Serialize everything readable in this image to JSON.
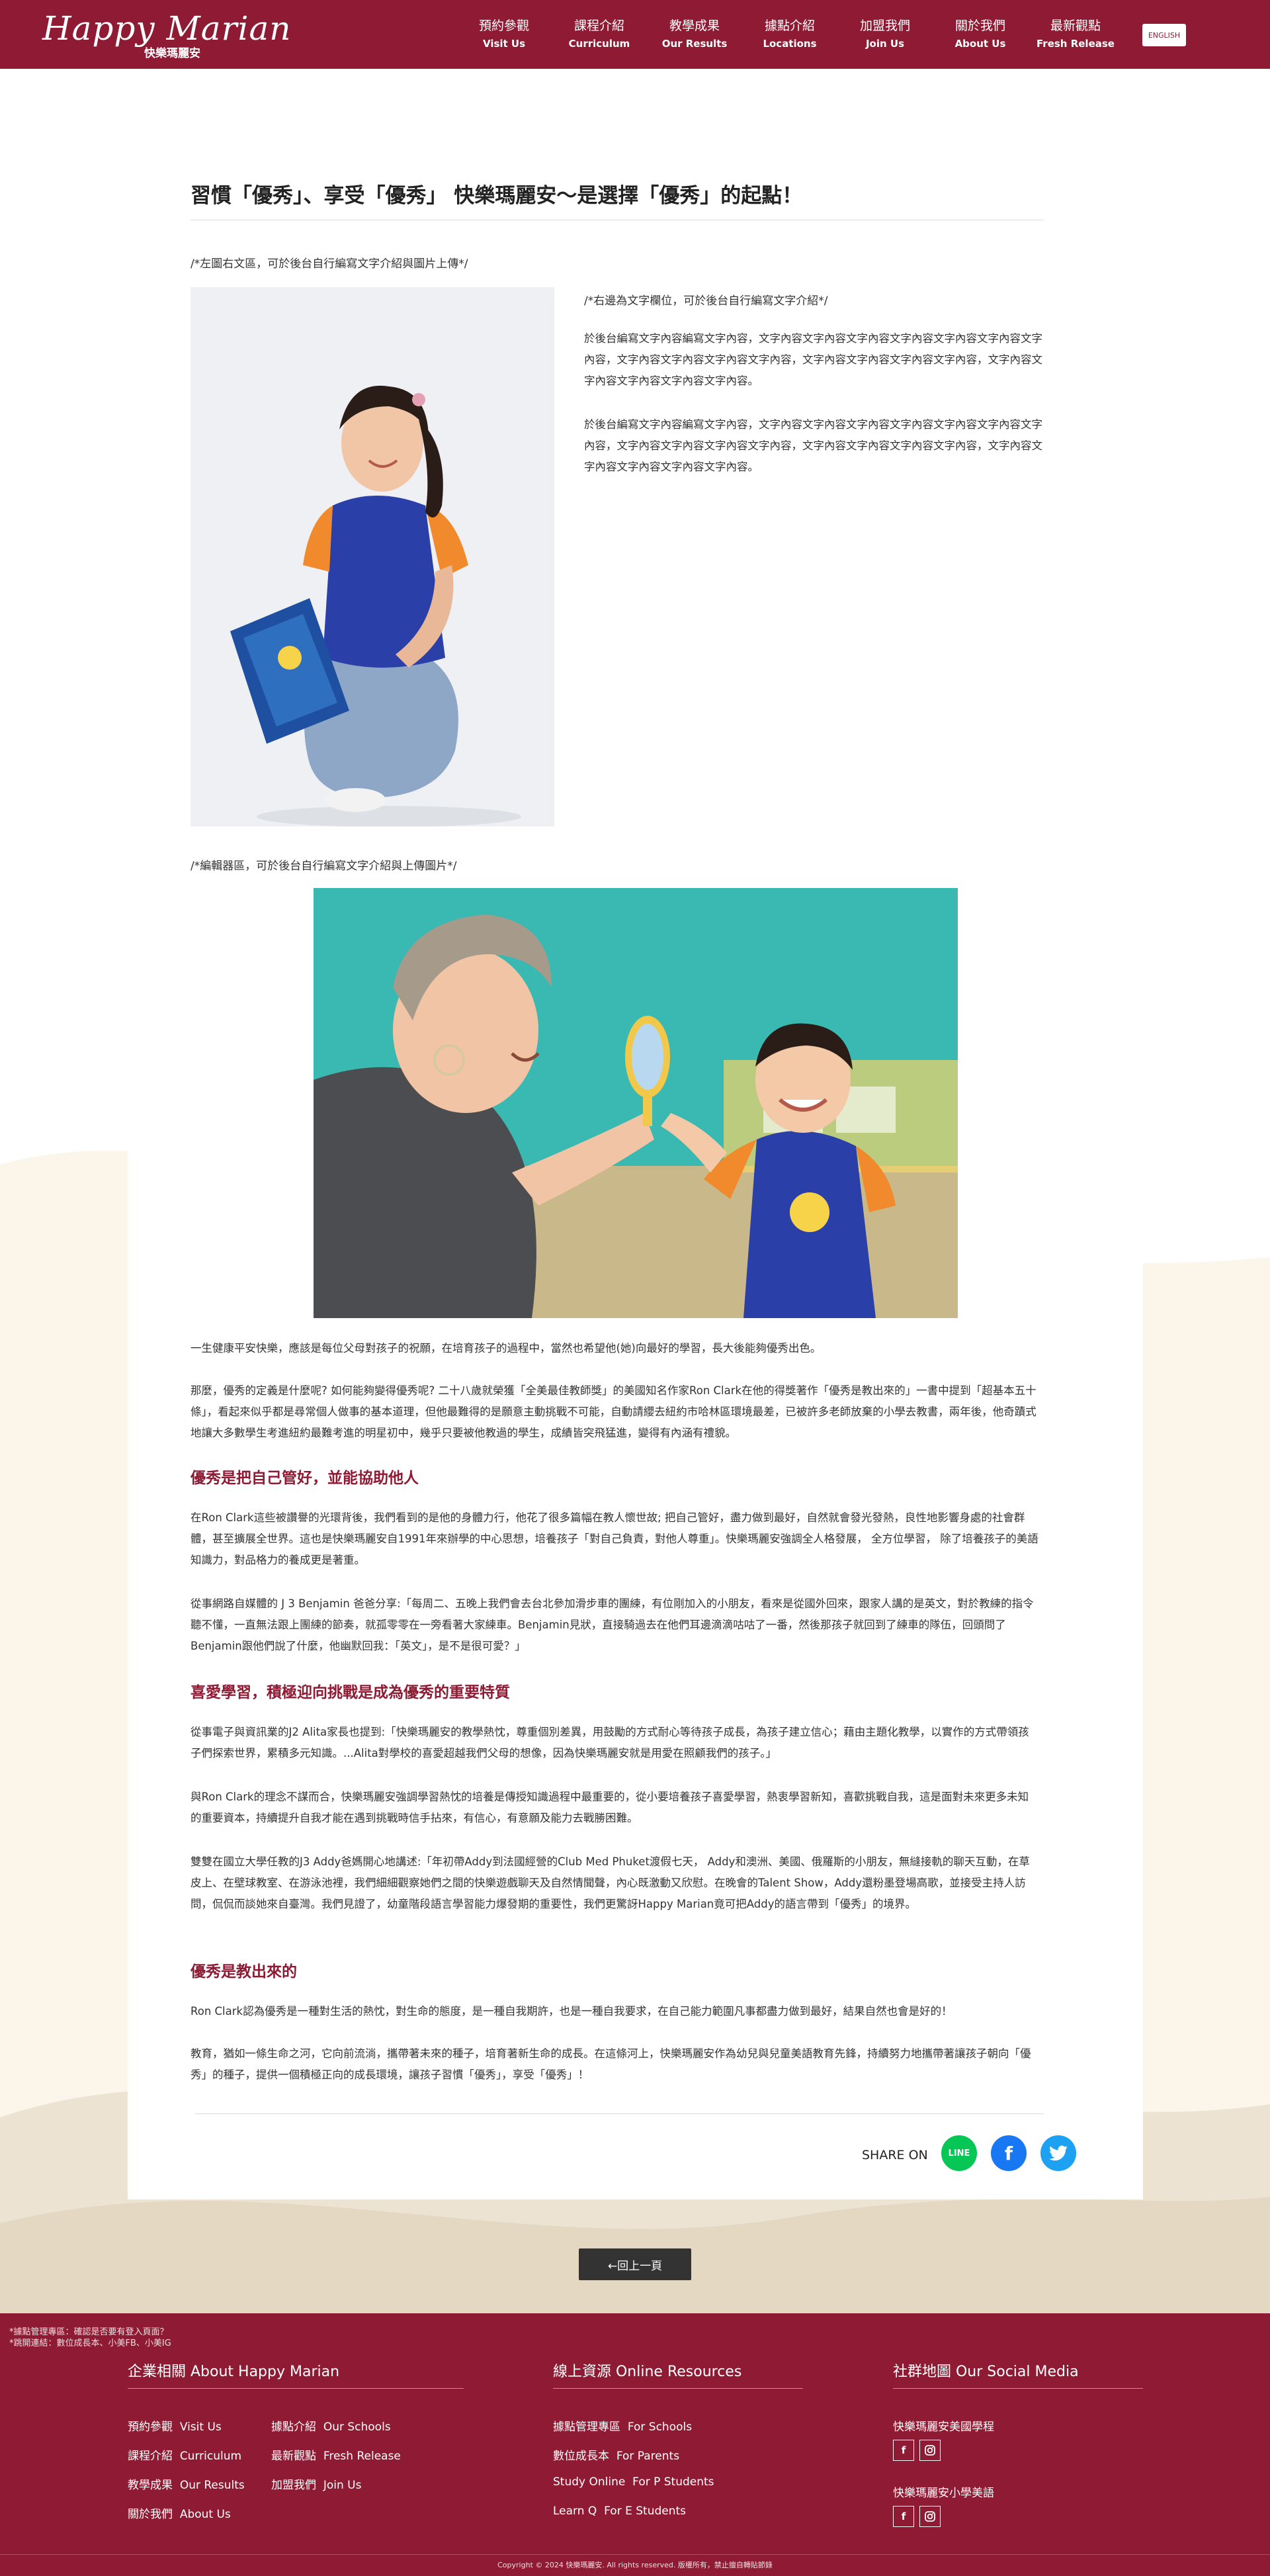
{
  "header": {
    "logo_en": "Happy Marian",
    "logo_zh": "快樂瑪麗安",
    "nav": [
      {
        "zh": "預約參觀",
        "en": "Visit Us"
      },
      {
        "zh": "課程介紹",
        "en": "Curriculum"
      },
      {
        "zh": "教學成果",
        "en": "Our Results"
      },
      {
        "zh": "據點介紹",
        "en": "Locations"
      },
      {
        "zh": "加盟我們",
        "en": "Join Us"
      },
      {
        "zh": "關於我們",
        "en": "About Us"
      },
      {
        "zh": "最新觀點",
        "en": "Fresh Release"
      }
    ],
    "lang_button": "ENGLISH"
  },
  "article": {
    "title": "習慣「優秀」、享受「優秀」 快樂瑪麗安～是選擇「優秀」的起點！",
    "left_image_caption": "/*左圖右文區，可於後台自行編寫文字介紹與圖片上傳*/",
    "right_caption": "/*右邊為文字欄位，可於後台自行編寫文字介紹*/",
    "right_paragraphs": [
      "於後台編寫文字內容編寫文字內容，文字內容文字內容文字內容文字內容文字內容文字內容文字內容，文字內容文字內容文字內容文字內容，文字內容文字內容文字內容文字內容，文字內容文字內容文字內容文字內容文字內容。",
      "於後台編寫文字內容編寫文字內容，文字內容文字內容文字內容文字內容文字內容文字內容文字內容，文字內容文字內容文字內容文字內容，文字內容文字內容文字內容文字內容，文字內容文字內容文字內容文字內容文字內容。"
    ],
    "editor_caption": "/*編輯器區，可於後台自行編寫文字介紹與上傳圖片*/",
    "paragraphs": [
      "一生健康平安快樂，應該是每位父母對孩子的祝願，在培育孩子的過程中，當然也希望他(她)向最好的學習，長大後能夠優秀出色。",
      "那麼，優秀的定義是什麼呢? 如何能夠變得優秀呢? 二十八歲就榮獲「全美最佳教師獎」的美國知名作家Ron Clark在他的得獎著作「優秀是教出來的」一書中提到「超基本五十條」，看起來似乎都是尋常個人做事的基本道理，但他最難得的是願意主動挑戰不可能，自動請纓去紐約市哈林區環境最差，已被許多老師放棄的小學去教書，兩年後，他奇蹟式地讓大多數學生考進紐約最難考進的明星初中，幾乎只要被他教過的學生，成績皆突飛猛進，變得有內涵有禮貌。"
    ],
    "sections": [
      {
        "heading": "優秀是把自己管好，並能協助他人",
        "paragraphs": [
          "在Ron Clark這些被讚譽的光環背後，我們看到的是他的身體力行，他花了很多篇幅在教人懷世故; 把自己管好，盡力做到最好，自然就會發光發熱，良性地影響身處的社會群體，甚至擴展全世界。這也是快樂瑪麗安自1991年來辦學的中心思想，培養孩子「對自己負責，對他人尊重」。快樂瑪麗安強調全人格發展， 全方位學習， 除了培養孩子的美語知識力，對品格力的養成更是著重。",
          "從事網路自媒體的 J 3 Benjamin 爸爸分享:「每周二、五晚上我們會去台北參加滑步車的團練，有位剛加入的小朋友，看來是從國外回來，跟家人講的是英文，對於教練的指令聽不懂，一直無法跟上團練的節奏，就孤零零在一旁看著大家練車。Benjamin見狀，直接騎過去在他們耳邊滴滴咕咕了一番，然後那孩子就回到了練車的隊伍，回頭問了Benjamin跟他們說了什麼，他幽默回我：「英文」，是不是很可愛？」"
        ]
      },
      {
        "heading": "喜愛學習，積極迎向挑戰是成為優秀的重要特質",
        "paragraphs": [
          "從事電子與資訊業的J2 Alita家長也提到:「快樂瑪麗安的教學熱忱，尊重個別差異，用鼓勵的方式耐心等待孩子成長，為孩子建立信心；藉由主題化教學，以實作的方式帶領孩子們探索世界，累積多元知識。...Alita對學校的喜愛超越我們父母的想像，因為快樂瑪麗安就是用愛在照顧我們的孩子。」",
          "與Ron Clark的理念不謀而合，快樂瑪麗安強調學習熱忱的培養是傳授知識過程中最重要的，從小要培養孩子喜愛學習，熱衷學習新知，喜歡挑戰自我，這是面對未來更多未知的重要資本，持續提升自我才能在遇到挑戰時信手拈來，有信心，有意願及能力去戰勝困難。",
          "雙雙在國立大學任教的J3 Addy爸媽開心地講述:「年初帶Addy到法國經營的Club Med Phuket渡假七天， Addy和澳洲、美國、俄羅斯的小朋友，無縫接軌的聊天互動，在草皮上、在壁球教室、在游泳池裡，我們細細觀察她們之間的快樂遊戲聊天及自然情聞聲，內心既激動又欣慰。在晚會的Talent Show，Addy還粉墨登場高歌，並接受主持人訪問，侃侃而談她來自臺灣。我們見證了，幼童階段語言學習能力爆發期的重要性，我們更驚訝Happy Marian竟可把Addy的語言帶到「優秀」的境界。"
        ]
      },
      {
        "heading": "優秀是教出來的",
        "paragraphs": [
          "Ron Clark認為優秀是一種對生活的熱忱，對生命的態度，是一種自我期許，也是一種自我要求，在自己能力範圍凡事都盡力做到最好，結果自然也會是好的！",
          "教育，猶如一條生命之河，它向前流淌，攜帶著未來的種子，培育著新生命的成長。在這條河上，快樂瑪麗安作為幼兒與兒童美語教育先鋒，持續努力地攜帶著讓孩子朝向「優秀」的種子，提供一個積極正向的成長環境，讓孩子習慣「優秀」，享受「優秀」！"
        ]
      }
    ],
    "share_label": "SHARE ON",
    "share_icons": [
      "line-icon",
      "facebook-icon",
      "twitter-icon"
    ]
  },
  "back_button": "←回上一頁",
  "footer": {
    "notes": [
      "*據點管理專區：確認是否要有登入頁面？",
      "*跳開連結：數位成長本、小美FB、小美IG"
    ],
    "col1": {
      "title": "企業相關 About Happy Marian",
      "links": [
        {
          "zh": "預約參觀",
          "en": "Visit Us"
        },
        {
          "zh": "據點介紹",
          "en": "Our Schools"
        },
        {
          "zh": "課程介紹",
          "en": "Curriculum"
        },
        {
          "zh": "最新觀點",
          "en": "Fresh Release"
        },
        {
          "zh": "教學成果",
          "en": "Our Results"
        },
        {
          "zh": "加盟我們",
          "en": "Join Us"
        },
        {
          "zh": "關於我們",
          "en": "About Us"
        }
      ]
    },
    "col2": {
      "title": "線上資源 Online Resources",
      "links": [
        {
          "zh": "據點管理專區",
          "en": "For Schools"
        },
        {
          "zh": "數位成長本",
          "en": "For Parents"
        },
        {
          "zh": "Study Online",
          "en": "For P Students"
        },
        {
          "zh": "Learn Q",
          "en": "For E Students"
        }
      ]
    },
    "col3": {
      "title": "社群地圖 Our Social Media",
      "groups": [
        "快樂瑪麗安美國學程",
        "快樂瑪麗安小學美語"
      ]
    },
    "copyright": "Copyright © 2024 快樂瑪麗安. All rights reserved. 版權所有，禁止擅自轉貼節錄"
  },
  "colors": {
    "brand": "#8e1a33",
    "heading": "#8e1a33",
    "line": "#06c755",
    "facebook": "#1877f2",
    "twitter": "#1da1f2"
  }
}
